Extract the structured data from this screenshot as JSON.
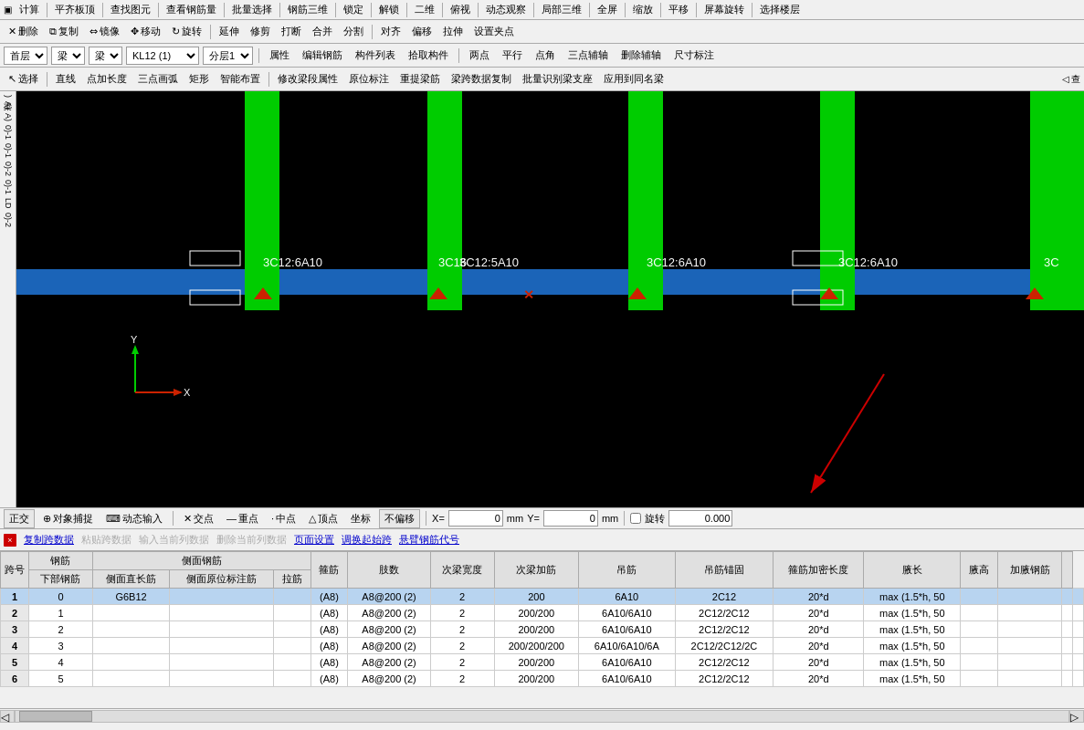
{
  "menubar": {
    "items": [
      "计算",
      "平齐板顶",
      "查找图元",
      "查看钢筋量",
      "批量选择",
      "钢筋三维",
      "锁定",
      "解锁",
      "二维",
      "俯视",
      "动态观察",
      "局部三维",
      "全屏",
      "缩放",
      "平移",
      "屏幕旋转",
      "选择楼层"
    ]
  },
  "toolbar1": {
    "items": [
      "删除",
      "复制",
      "镜像",
      "移动",
      "旋转",
      "延伸",
      "修剪",
      "打断",
      "合并",
      "分割",
      "对齐",
      "偏移",
      "拉伸",
      "设置夹点"
    ]
  },
  "propsbar": {
    "floor": "首层",
    "type": "梁",
    "subtype": "梁",
    "kl": "KL12 (1)",
    "layer": "分层1"
  },
  "drawtools": {
    "items": [
      "选择",
      "直线",
      "点加长度",
      "三点画弧",
      "矩形",
      "智能布置",
      "修改梁段属性",
      "原位标注",
      "重提梁筋",
      "梁跨数据复制",
      "批量识别梁支座",
      "应用到同名梁"
    ]
  },
  "toolbar2": {
    "items": [
      "属性",
      "编辑钢筋",
      "构件列表",
      "拾取构件",
      "两点",
      "平行",
      "点角",
      "三点辅轴",
      "删除辅轴",
      "尺寸标注"
    ]
  },
  "coordbar": {
    "items": [
      "正交",
      "对象捕捉",
      "动态输入",
      "交点",
      "重点",
      "中点",
      "顶点",
      "坐标",
      "不偏移"
    ],
    "x_label": "X=",
    "x_val": "0",
    "x_unit": "mm",
    "y_label": "Y=",
    "y_val": "0",
    "y_unit": "mm",
    "rotate_label": "旋转",
    "rotate_val": "0.000"
  },
  "datapanel": {
    "buttons": [
      "复制跨数据",
      "粘贴跨数据",
      "输入当前列数据",
      "删除当前列数据",
      "页面设置",
      "调换起始跨",
      "悬臂钢筋代号"
    ],
    "headers": [
      "跨号",
      "钢筋\n下部钢筋",
      "侧面钢筋\n侧面直长筋",
      "侧面钢筋\n侧面原位标注筋",
      "侧面钢筋\n拉筋",
      "箍筋",
      "肢数",
      "次梁宽度",
      "次梁加筋",
      "吊筋",
      "吊筋锚固",
      "箍筋加密长度",
      "腋长",
      "腋高",
      "加腋钢筋"
    ],
    "rows": [
      {
        "id": 1,
        "kh": "0",
        "lower": "G6B12",
        "side_long": "",
        "side_label": "",
        "pull": "(A8)",
        "hoop": "A8@200 (2)",
        "legs": "2",
        "beam_width": "200",
        "beam_add": "6A10",
        "hang": "2C12",
        "anchor": "20*d",
        "dense_len": "max (1.5*h, 50",
        "ax": "",
        "ah": "",
        "add_steel": "",
        "selected": true
      },
      {
        "id": 2,
        "kh": "1",
        "lower": "",
        "side_long": "",
        "side_label": "",
        "pull": "(A8)",
        "hoop": "A8@200 (2)",
        "legs": "2",
        "beam_width": "200/200",
        "beam_add": "6A10/6A10",
        "hang": "2C12/2C12",
        "anchor": "20*d",
        "dense_len": "max (1.5*h, 50",
        "ax": "",
        "ah": "",
        "add_steel": "",
        "selected": false
      },
      {
        "id": 3,
        "kh": "2",
        "lower": "",
        "side_long": "",
        "side_label": "",
        "pull": "(A8)",
        "hoop": "A8@200 (2)",
        "legs": "2",
        "beam_width": "200/200",
        "beam_add": "6A10/6A10",
        "hang": "2C12/2C12",
        "anchor": "20*d",
        "dense_len": "max (1.5*h, 50",
        "ax": "",
        "ah": "",
        "add_steel": "",
        "selected": false
      },
      {
        "id": 4,
        "kh": "3",
        "lower": "",
        "side_long": "",
        "side_label": "",
        "pull": "(A8)",
        "hoop": "A8@200 (2)",
        "legs": "2",
        "beam_width": "200/200/200",
        "beam_add": "6A10/6A10/6A",
        "hang": "2C12/2C12/2C",
        "anchor": "20*d",
        "dense_len": "max (1.5*h, 50",
        "ax": "",
        "ah": "",
        "add_steel": "",
        "selected": false
      },
      {
        "id": 5,
        "kh": "4",
        "lower": "",
        "side_long": "",
        "side_label": "",
        "pull": "(A8)",
        "hoop": "A8@200 (2)",
        "legs": "2",
        "beam_width": "200/200",
        "beam_add": "6A10/6A10",
        "hang": "2C12/2C12",
        "anchor": "20*d",
        "dense_len": "max (1.5*h, 50",
        "ax": "",
        "ah": "",
        "add_steel": "",
        "selected": false
      },
      {
        "id": 6,
        "kh": "5",
        "lower": "",
        "side_long": "",
        "side_label": "",
        "pull": "(A8)",
        "hoop": "A8@200 (2)",
        "legs": "2",
        "beam_width": "200/200",
        "beam_add": "6A10/6A10",
        "hang": "2C12/2C12",
        "anchor": "20*d",
        "dense_len": "max (1.5*h, 50",
        "ax": "",
        "ah": "",
        "add_steel": "",
        "selected": false
      }
    ],
    "canvas_labels": [
      "3C12:6A10",
      "3C16",
      "3C12:5A10",
      "3C12:6A10",
      "3C12:6A10",
      "3C"
    ]
  },
  "leftpanel": {
    "items": [
      "梁",
      "A",
      "A",
      "0)-1",
      "0)-1",
      "0)-2",
      "0)-1",
      "1.D",
      "0)-2"
    ]
  },
  "arrow": {
    "color": "#cc0000"
  }
}
